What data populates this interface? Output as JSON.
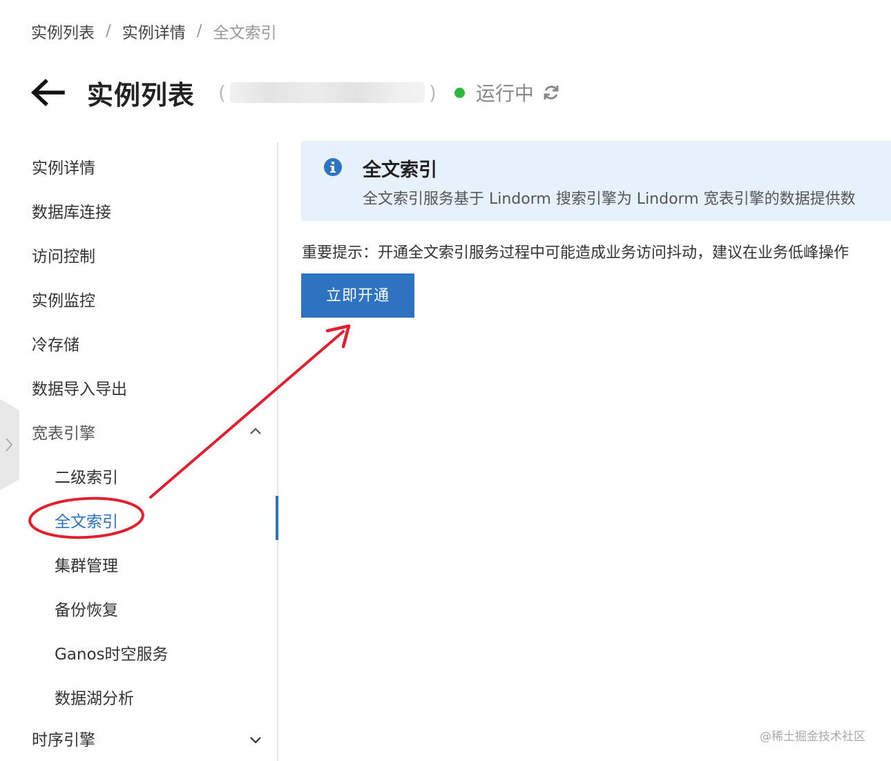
{
  "breadcrumb": {
    "items": [
      "实例列表",
      "实例详情",
      "全文索引"
    ],
    "separator": "/"
  },
  "header": {
    "title": "实例列表",
    "paren_open": "(",
    "paren_close": ")",
    "status": "运行中",
    "status_color": "#2fb83f"
  },
  "sidebar": {
    "items": [
      {
        "label": "实例详情"
      },
      {
        "label": "数据库连接"
      },
      {
        "label": "访问控制"
      },
      {
        "label": "实例监控"
      },
      {
        "label": "冷存储"
      },
      {
        "label": "数据导入导出"
      }
    ],
    "wide_table_group": {
      "label": "宽表引擎",
      "expanded": true,
      "children": [
        {
          "label": "二级索引"
        },
        {
          "label": "全文索引",
          "active": true
        },
        {
          "label": "集群管理"
        },
        {
          "label": "备份恢复"
        },
        {
          "label": "Ganos时空服务"
        },
        {
          "label": "数据湖分析"
        }
      ]
    },
    "timeseries_group": {
      "label": "时序引擎",
      "expanded": false
    }
  },
  "info_box": {
    "icon": "info-circle-icon",
    "title": "全文索引",
    "description": "全文索引服务基于 Lindorm 搜索引擎为 Lindorm 宽表引擎的数据提供数"
  },
  "notice": "重要提示：开通全文索引服务过程中可能造成业务访问抖动，建议在业务低峰操作",
  "primary_button": {
    "label": "立即开通"
  },
  "watermark": "@稀土掘金技术社区",
  "colors": {
    "accent": "#2d73c1",
    "info_bg": "#e6f1fb",
    "annotation": "#e0202e"
  }
}
